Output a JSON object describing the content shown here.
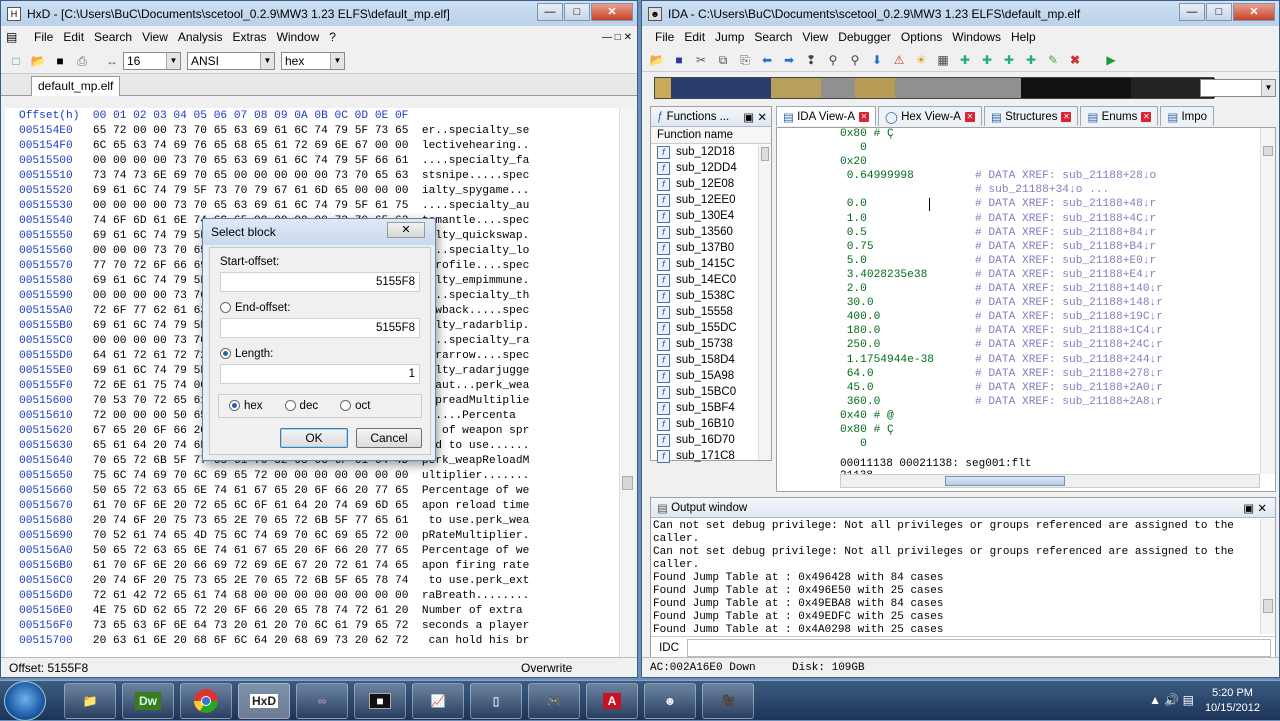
{
  "hxd": {
    "title": "HxD - [C:\\Users\\BuC\\Documents\\scetool_0.2.9\\MW3 1.23 ELFS\\default_mp.elf]",
    "menu": [
      "File",
      "Edit",
      "Search",
      "View",
      "Analysis",
      "Extras",
      "Window",
      "?"
    ],
    "toolbar": {
      "columns": "16",
      "charset": "ANSI",
      "mode": "hex"
    },
    "tab": "default_mp.elf",
    "header": "Offset(h)  00 01 02 03 04 05 06 07 08 09 0A 0B 0C 0D 0E 0F",
    "rows": [
      {
        "off": "005154E0",
        "hex": "65 72 00 00 73 70 65 63 69 61 6C 74 79 5F 73 65",
        "txt": "er..specialty_se"
      },
      {
        "off": "005154F0",
        "hex": "6C 65 63 74 69 76 65 68 65 61 72 69 6E 67 00 00",
        "txt": "lectivehearing.."
      },
      {
        "off": "00515500",
        "hex": "00 00 00 00 73 70 65 63 69 61 6C 74 79 5F 66 61",
        "txt": "....specialty_fa"
      },
      {
        "off": "00515510",
        "hex": "73 74 73 6E 69 70 65 00 00 00 00 00 73 70 65 63",
        "txt": "stsnipe.....spec"
      },
      {
        "off": "00515520",
        "hex": "69 61 6C 74 79 5F 73 70 79 67 61 6D 65 00 00 00",
        "txt": "ialty_spygame..."
      },
      {
        "off": "00515530",
        "hex": "00 00 00 00 73 70 65 63 69 61 6C 74 79 5F 61 75",
        "txt": "....specialty_au"
      },
      {
        "off": "00515540",
        "hex": "74 6F 6D 61 6E 74 6C 65 00 00 00 00 73 70 65 63",
        "txt": "tomantle....spec"
      },
      {
        "off": "00515550",
        "hex": "69 61 6C 74 79 5F 71 75 69 63 6B 73 77 61 70 2E",
        "txt": "ialty_quickswap."
      },
      {
        "off": "00515560",
        "hex": "00 00 00 73 70 65 63 69 61 6C 74 79 5F 6C 6F 6F",
        "txt": "....specialty_lo"
      },
      {
        "off": "00515570",
        "hex": "77 70 72 6F 66 69 6C 65 00 00 00 00 73 70 65 63",
        "txt": "wprofile....spec"
      },
      {
        "off": "00515580",
        "hex": "69 61 6C 74 79 5F 65 6D 70 69 6D 6D 75 6E 65 2E",
        "txt": "ialty_empimmune."
      },
      {
        "off": "00515590",
        "hex": "00 00 00 00 73 70 65 63 69 61 6C 74 79 5F 74 68",
        "txt": "....specialty_th"
      },
      {
        "off": "005155A0",
        "hex": "72 6F 77 62 61 63 6B 00 00 00 00 00 73 70 65 63",
        "txt": "rowback.....spec"
      },
      {
        "off": "005155B0",
        "hex": "69 61 6C 74 79 5F 72 61 64 61 72 62 6C 69 70 2E",
        "txt": "ialty_radarblip."
      },
      {
        "off": "005155C0",
        "hex": "00 00 00 00 73 70 65 63 69 61 6C 74 79 5F 72 61",
        "txt": "....specialty_ra"
      },
      {
        "off": "005155D0",
        "hex": "64 61 72 61 72 72 6F 77 00 00 00 00 73 70 65 63",
        "txt": "dararrow....spec"
      },
      {
        "off": "005155E0",
        "hex": "69 61 6C 74 79 5F 72 61 64 61 72 6A 75 67 67 65",
        "txt": "ialty_radarjugge"
      },
      {
        "off": "005155F0",
        "hex": "72 6E 61 75 74 00 00 00 70 65 72 6B 5F 77 65 61",
        "txt": "rnaut...perk_wea"
      },
      {
        "off": "00515600",
        "hex": "70 53 70 72 65 61 64 4D 75 6C 74 69 70 6C 69 65",
        "txt": "pSpreadMultiplie"
      },
      {
        "off": "00515610",
        "hex": "72 00 00 00 50 65 72 63 65 6E 74 61 67 65 20 6F",
        "txt": "r.....Percenta"
      },
      {
        "off": "00515620",
        "hex": "67 65 20 6F 66 20 77 65 61 70 6F 6E 20 73 70 72",
        "txt": "ge of weapon spr"
      },
      {
        "off": "00515630",
        "hex": "65 61 64 20 74 6F 20 75 73 65 2E 00 00 00 00 00",
        "txt": "ead to use......"
      },
      {
        "off": "00515640",
        "hex": "70 65 72 6B 5F 77 65 61 70 52 65 6C 6F 61 64 4D",
        "txt": "perk_weapReloadM"
      },
      {
        "off": "00515650",
        "hex": "75 6C 74 69 70 6C 69 65 72 00 00 00 00 00 00 00",
        "txt": "ultiplier......."
      },
      {
        "off": "00515660",
        "hex": "50 65 72 63 65 6E 74 61 67 65 20 6F 66 20 77 65",
        "txt": "Percentage of we"
      },
      {
        "off": "00515670",
        "hex": "61 70 6F 6E 20 72 65 6C 6F 61 64 20 74 69 6D 65",
        "txt": "apon reload time"
      },
      {
        "off": "00515680",
        "hex": "20 74 6F 20 75 73 65 2E 70 65 72 6B 5F 77 65 61",
        "txt": " to use.perk_wea"
      },
      {
        "off": "00515690",
        "hex": "70 52 61 74 65 4D 75 6C 74 69 70 6C 69 65 72 00",
        "txt": "pRateMultiplier."
      },
      {
        "off": "005156A0",
        "hex": "50 65 72 63 65 6E 74 61 67 65 20 6F 66 20 77 65",
        "txt": "Percentage of we"
      },
      {
        "off": "005156B0",
        "hex": "61 70 6F 6E 20 66 69 72 69 6E 67 20 72 61 74 65",
        "txt": "apon firing rate"
      },
      {
        "off": "005156C0",
        "hex": "20 74 6F 20 75 73 65 2E 70 65 72 6B 5F 65 78 74",
        "txt": " to use.perk_ext"
      },
      {
        "off": "005156D0",
        "hex": "72 61 42 72 65 61 74 68 00 00 00 00 00 00 00 00",
        "txt": "raBreath........"
      },
      {
        "off": "005156E0",
        "hex": "4E 75 6D 62 65 72 20 6F 66 20 65 78 74 72 61 20",
        "txt": "Number of extra "
      },
      {
        "off": "005156F0",
        "hex": "73 65 63 6F 6E 64 73 20 61 20 70 6C 61 79 65 72",
        "txt": "seconds a player"
      },
      {
        "off": "00515700",
        "hex": "20 63 61 6E 20 68 6F 6C 64 20 68 69 73 20 62 72",
        "txt": " can hold his br"
      }
    ],
    "status": {
      "offset": "Offset: 5155F8",
      "mode": "Overwrite"
    }
  },
  "dialog": {
    "title": "Select block",
    "start_label": "Start-offset:",
    "start_value": "5155F8",
    "end_label": "End-offset:",
    "end_value": "5155F8",
    "length_label": "Length:",
    "length_value": "1",
    "radios": [
      "hex",
      "dec",
      "oct"
    ],
    "ok": "OK",
    "cancel": "Cancel"
  },
  "ida": {
    "title": "IDA - C:\\Users\\BuC\\Documents\\scetool_0.2.9\\MW3 1.23 ELFS\\default_mp.elf",
    "menu": [
      "File",
      "Edit",
      "Jump",
      "Search",
      "View",
      "Debugger",
      "Options",
      "Windows",
      "Help"
    ],
    "functions": {
      "title": "Functions ...",
      "col": "Function name",
      "items": [
        "sub_12D18",
        "sub_12DD4",
        "sub_12E08",
        "sub_12EE0",
        "sub_130E4",
        "sub_13560",
        "sub_137B0",
        "sub_1415C",
        "sub_14EC0",
        "sub_1538C",
        "sub_15558",
        "sub_155DC",
        "sub_15738",
        "sub_158D4",
        "sub_15A98",
        "sub_15BC0",
        "sub_15BF4",
        "sub_16B10",
        "sub_16D70",
        "sub_171C8"
      ]
    },
    "tabs": [
      "IDA View-A",
      "Hex View-A",
      "Structures",
      "Enums",
      "Impo"
    ],
    "code": [
      {
        "v": "0x80 # Ç",
        "c": ""
      },
      {
        "v": "   0",
        "c": ""
      },
      {
        "v": "0x20",
        "c": ""
      },
      {
        "v": " 0.64999998",
        "c": "# DATA XREF: sub_21188+28↓o"
      },
      {
        "v": "",
        "c": "# sub_21188+34↓o ..."
      },
      {
        "v": " 0.0",
        "c": "# DATA XREF: sub_21188+48↓r"
      },
      {
        "v": " 1.0",
        "c": "# DATA XREF: sub_21188+4C↓r"
      },
      {
        "v": " 0.5",
        "c": "# DATA XREF: sub_21188+84↓r"
      },
      {
        "v": " 0.75",
        "c": "# DATA XREF: sub_21188+B4↓r"
      },
      {
        "v": " 5.0",
        "c": "# DATA XREF: sub_21188+E0↓r"
      },
      {
        "v": " 3.4028235e38",
        "c": "# DATA XREF: sub_21188+E4↓r"
      },
      {
        "v": " 2.0",
        "c": "# DATA XREF: sub_21188+140↓r"
      },
      {
        "v": " 30.0",
        "c": "# DATA XREF: sub_21188+148↓r"
      },
      {
        "v": " 400.0",
        "c": "# DATA XREF: sub_21188+19C↓r"
      },
      {
        "v": " 180.0",
        "c": "# DATA XREF: sub_21188+1C4↓r"
      },
      {
        "v": " 250.0",
        "c": "# DATA XREF: sub_21188+24C↓r"
      },
      {
        "v": " 1.1754944e-38",
        "c": "# DATA XREF: sub_21188+244↓r"
      },
      {
        "v": " 64.0",
        "c": "# DATA XREF: sub_21188+278↓r"
      },
      {
        "v": " 45.0",
        "c": "# DATA XREF: sub_21188+2A0↓r"
      },
      {
        "v": " 360.0",
        "c": "# DATA XREF: sub_21188+2A8↓r"
      },
      {
        "v": "0x40 # @",
        "c": ""
      },
      {
        "v": "0x80 # Ç",
        "c": ""
      },
      {
        "v": "   0",
        "c": ""
      }
    ],
    "location": "00011138 00021138: seg001:flt 21138",
    "output": {
      "title": "Output window",
      "lines": [
        "Can not set debug privilege: Not all privileges or groups referenced are assigned to the",
        "caller.",
        "Can not set debug privilege: Not all privileges or groups referenced are assigned to the",
        "caller.",
        "Found Jump Table at : 0x496428 with 84 cases",
        "Found Jump Table at : 0x496E50 with 25 cases",
        "Found Jump Table at : 0x49EBA8 with 84 cases",
        "Found Jump Table at : 0x49EDFC with 25 cases",
        "Found Jump Table at : 0x4A0298 with 25 cases"
      ],
      "prompt": "IDC"
    },
    "status": {
      "left": "AC:002A16E0 Down",
      "disk": "Disk: 109GB"
    }
  },
  "taskbar": {
    "apps": [
      "folder",
      "Dw",
      "chrome",
      "HxD",
      "ida",
      "cmd",
      "excel",
      "tool",
      "game",
      "pdf",
      "face",
      "cam"
    ],
    "time": "5:20 PM",
    "date": "10/15/2012"
  }
}
